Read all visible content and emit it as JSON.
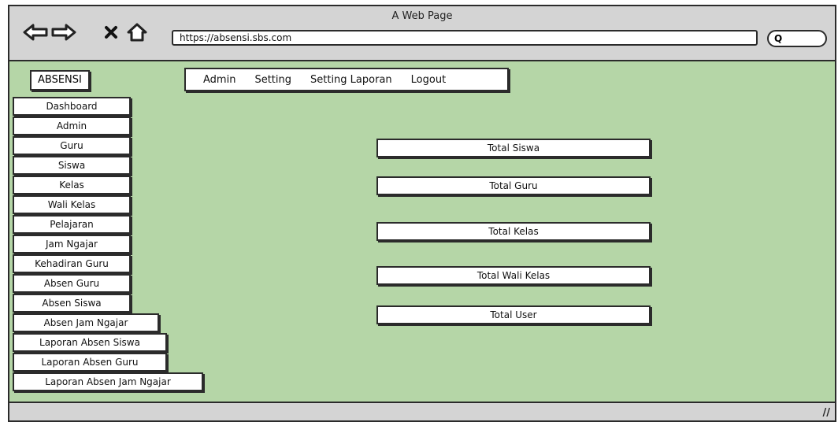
{
  "window": {
    "title": "A Web Page"
  },
  "browser": {
    "url": "https://absensi.sbs.com",
    "back_icon": "back-arrow-icon",
    "forward_icon": "forward-arrow-icon",
    "close_icon": "close-icon",
    "home_icon": "home-icon",
    "search_glyph": "Q"
  },
  "app": {
    "brand": "ABSENSI"
  },
  "top_menu": [
    "Admin",
    "Setting",
    "Setting Laporan",
    "Logout"
  ],
  "sidebar": [
    "Dashboard",
    "Admin",
    "Guru",
    "Siswa",
    "Kelas",
    "Wali Kelas",
    "Pelajaran",
    "Jam Ngajar",
    "Kehadiran Guru",
    "Absen Guru",
    "Absen Siswa",
    "Absen Jam Ngajar",
    "Laporan Absen Siswa",
    "Laporan Absen Guru",
    "Laporan Absen Jam Ngajar"
  ],
  "stats": [
    "Total Siswa",
    "Total Guru",
    "Total Kelas",
    "Total Wali Kelas",
    "Total User"
  ],
  "colors": {
    "page_bg": "#b5d6a7",
    "chrome": "#d4d4d4",
    "outline": "#2b2b2b"
  }
}
